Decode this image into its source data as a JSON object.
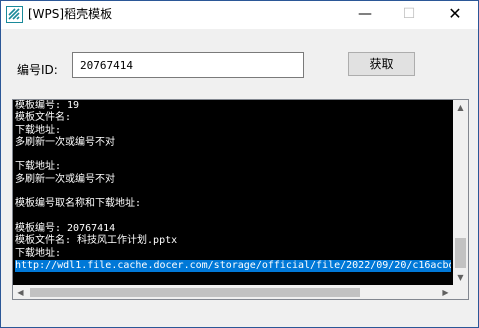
{
  "window": {
    "title": "[WPS]稻壳模板",
    "icon": "stripes-app-icon",
    "accent_color": "#1a8a9a"
  },
  "controls": {
    "minimize": "—",
    "maximize": "☐",
    "close": "✕"
  },
  "form": {
    "id_label": "编号ID:",
    "id_value": "20767414",
    "fetch_button": "获取"
  },
  "console": {
    "lines": [
      "模板编号: 19",
      "模板文件名:",
      "下载地址:",
      "多刷新一次或编号不对",
      "",
      "下载地址:",
      "多刷新一次或编号不对",
      "",
      "模板编号取名称和下载地址:",
      "",
      "模板编号: 20767414",
      "模板文件名: 科技风工作计划.pptx",
      "下载地址:",
      "http://wdl1.file.cache.docer.com/storage/official/file/2022/09/20/c16acbd"
    ],
    "selected_line_index": 13,
    "selection_color": "#0078d7"
  },
  "scrollbars": {
    "up_arrow": "▲",
    "down_arrow": "▼",
    "left_arrow": "◀",
    "right_arrow": "▶"
  }
}
